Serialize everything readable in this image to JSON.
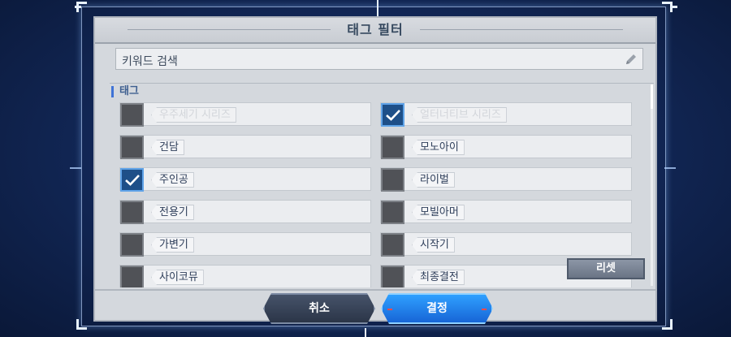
{
  "dialog": {
    "title": "태그 필터",
    "search": {
      "placeholder": "키워드 검색",
      "icon": "pencil-icon"
    },
    "section_label": "태그",
    "tags": [
      {
        "label": "우주세기 시리즈",
        "checked": false,
        "faded": true
      },
      {
        "label": "얼터너티브 시리즈",
        "checked": true,
        "faded": true
      },
      {
        "label": "건담",
        "checked": false,
        "faded": false
      },
      {
        "label": "모노아이",
        "checked": false,
        "faded": false
      },
      {
        "label": "주인공",
        "checked": true,
        "faded": false
      },
      {
        "label": "라이벌",
        "checked": false,
        "faded": false
      },
      {
        "label": "전용기",
        "checked": false,
        "faded": false
      },
      {
        "label": "모빌아머",
        "checked": false,
        "faded": false
      },
      {
        "label": "가변기",
        "checked": false,
        "faded": false
      },
      {
        "label": "시작기",
        "checked": false,
        "faded": false
      },
      {
        "label": "사이코뮤",
        "checked": false,
        "faded": false
      },
      {
        "label": "최종결전",
        "checked": false,
        "faded": false
      }
    ],
    "reset_label": "리셋"
  },
  "buttons": {
    "cancel_label": "취소",
    "confirm_label": "결정"
  },
  "colors": {
    "accent": "#2f8cff",
    "checked_box": "#1e4f88",
    "dialog_bg": "#d4d8dd"
  }
}
